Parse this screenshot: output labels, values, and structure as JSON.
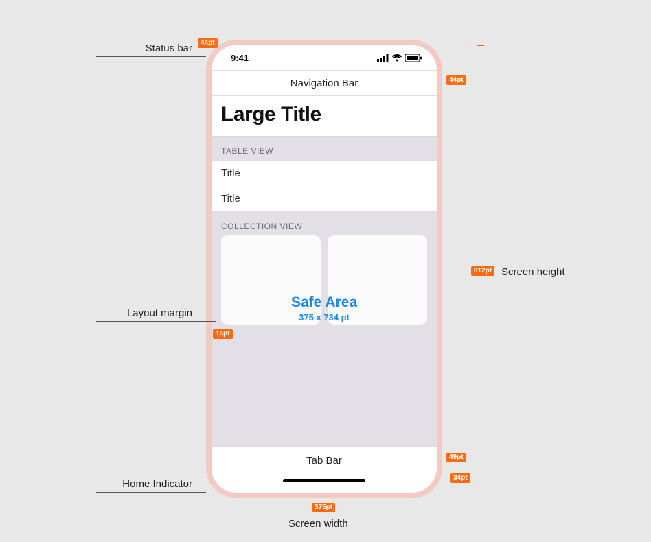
{
  "status_bar": {
    "time": "9:41"
  },
  "nav_bar": {
    "title": "Navigation Bar"
  },
  "large_title": "Large Title",
  "sections": {
    "table_view_header": "TABLE VIEW",
    "table_rows": [
      "Title",
      "Title"
    ],
    "collection_header": "COLLECTION VIEW"
  },
  "safe_area": {
    "title": "Safe Area",
    "size": "375 x 734 pt"
  },
  "tab_bar": {
    "title": "Tab Bar"
  },
  "external_labels": {
    "status_bar": "Status bar",
    "layout_margin": "Layout margin",
    "home_indicator": "Home Indicator",
    "screen_height": "Screen height",
    "screen_width": "Screen width"
  },
  "tags": {
    "status_bar_h": "44pt",
    "nav_bar_h": "44pt",
    "layout_margin_w": "16pt",
    "screen_height": "812pt",
    "tab_bar_h": "49pt",
    "home_indicator_h": "34pt",
    "screen_width": "375pt"
  }
}
